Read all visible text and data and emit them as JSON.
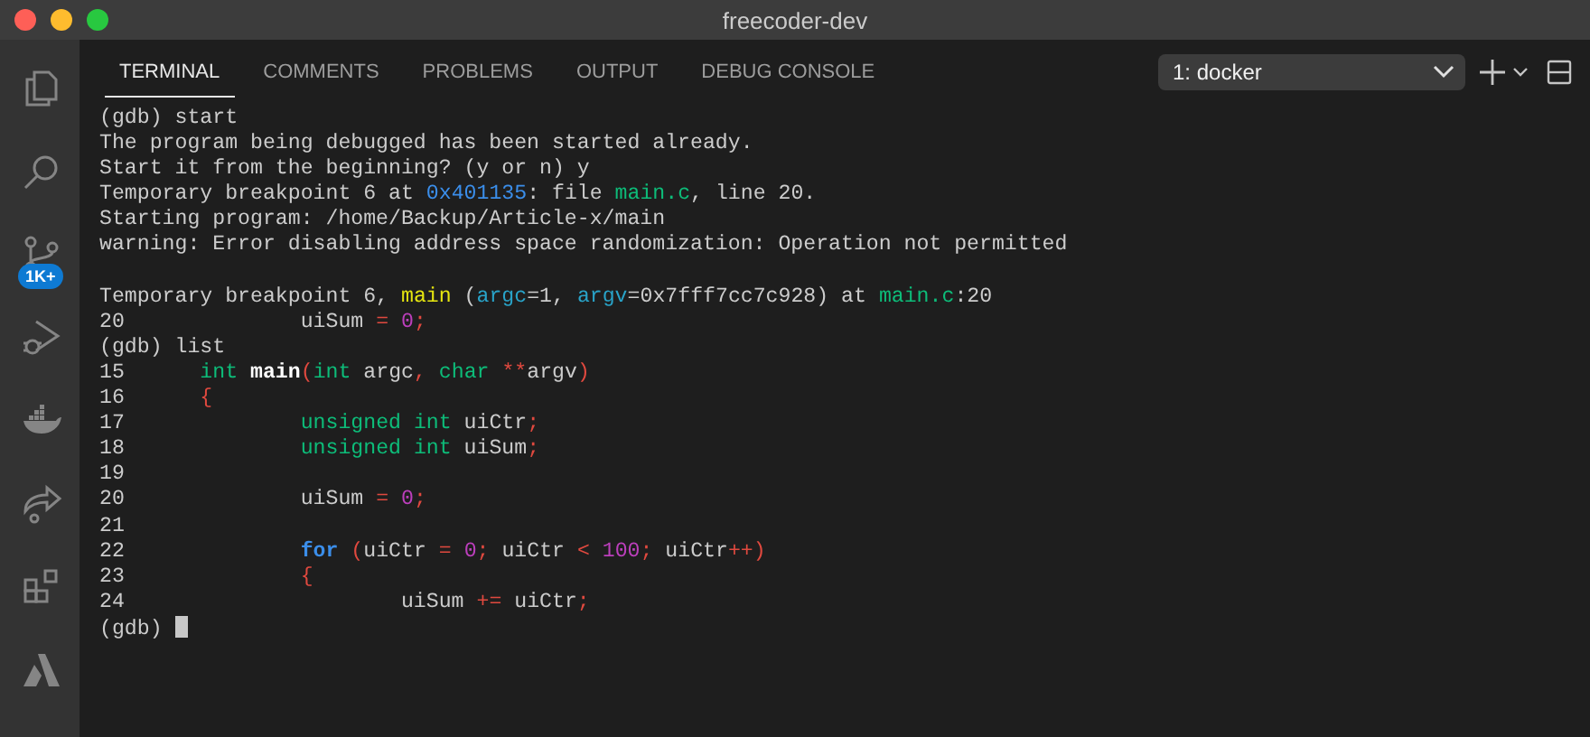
{
  "window": {
    "title": "freecoder-dev"
  },
  "activity_bar": {
    "items": [
      {
        "kind": "files",
        "selected": false
      },
      {
        "kind": "search",
        "selected": false
      },
      {
        "kind": "source-control",
        "selected": false,
        "badge": "1K+"
      },
      {
        "kind": "run-debug",
        "selected": false
      },
      {
        "kind": "docker",
        "selected": false
      },
      {
        "kind": "live-share",
        "selected": false
      },
      {
        "kind": "extensions",
        "selected": false
      },
      {
        "kind": "azure",
        "selected": false
      }
    ]
  },
  "panel_tabs": [
    {
      "label": "TERMINAL",
      "selected": true
    },
    {
      "label": "COMMENTS",
      "selected": false
    },
    {
      "label": "PROBLEMS",
      "selected": false
    },
    {
      "label": "OUTPUT",
      "selected": false
    },
    {
      "label": "DEBUG CONSOLE",
      "selected": false
    }
  ],
  "terminal_select": {
    "value": "1: docker"
  },
  "terminal": {
    "cursor": true,
    "lines": [
      {
        "kind": "text",
        "segments": [
          {
            "kind": "plain",
            "text": "(gdb) start"
          }
        ]
      },
      {
        "kind": "text",
        "segments": [
          {
            "kind": "plain",
            "text": "The program being debugged has been started already."
          }
        ]
      },
      {
        "kind": "text",
        "segments": [
          {
            "kind": "plain",
            "text": "Start it from the beginning? (y or n) y"
          }
        ]
      },
      {
        "kind": "text",
        "segments": [
          {
            "kind": "plain",
            "text": "Temporary breakpoint 6 at "
          },
          {
            "kind": "address",
            "text": "0x401135"
          },
          {
            "kind": "plain",
            "text": ": file "
          },
          {
            "kind": "file",
            "text": "main.c"
          },
          {
            "kind": "plain",
            "text": ", line 20."
          }
        ]
      },
      {
        "kind": "text",
        "segments": [
          {
            "kind": "plain",
            "text": "Starting program: /home/Backup/Article-x/main"
          }
        ]
      },
      {
        "kind": "text",
        "segments": [
          {
            "kind": "plain",
            "text": "warning: Error disabling address space randomization: Operation not permitted"
          }
        ]
      },
      {
        "kind": "blank"
      },
      {
        "kind": "text",
        "segments": [
          {
            "kind": "plain",
            "text": "Temporary breakpoint 6, "
          },
          {
            "kind": "function",
            "text": "main"
          },
          {
            "kind": "plain",
            "text": " ("
          },
          {
            "kind": "param",
            "text": "argc"
          },
          {
            "kind": "plain",
            "text": "=1, "
          },
          {
            "kind": "param",
            "text": "argv"
          },
          {
            "kind": "plain",
            "text": "=0x7fff7cc7c928) at "
          },
          {
            "kind": "file",
            "text": "main.c"
          },
          {
            "kind": "plain",
            "text": ":20"
          }
        ]
      },
      {
        "kind": "text",
        "segments": [
          {
            "kind": "plain",
            "text": "20              uiSum "
          },
          {
            "kind": "operator",
            "text": "= "
          },
          {
            "kind": "number",
            "text": "0"
          },
          {
            "kind": "operator",
            "text": ";"
          }
        ]
      },
      {
        "kind": "text",
        "segments": [
          {
            "kind": "plain",
            "text": "(gdb) list"
          }
        ]
      },
      {
        "kind": "text",
        "segments": [
          {
            "kind": "plain",
            "text": "15      "
          },
          {
            "kind": "type",
            "text": "int "
          },
          {
            "kind": "bold",
            "text": "main"
          },
          {
            "kind": "operator",
            "text": "("
          },
          {
            "kind": "type",
            "text": "int"
          },
          {
            "kind": "plain",
            "text": " argc"
          },
          {
            "kind": "operator",
            "text": ", "
          },
          {
            "kind": "type",
            "text": "char "
          },
          {
            "kind": "operator",
            "text": "**"
          },
          {
            "kind": "plain",
            "text": "argv"
          },
          {
            "kind": "operator",
            "text": ")"
          }
        ]
      },
      {
        "kind": "text",
        "segments": [
          {
            "kind": "plain",
            "text": "16      "
          },
          {
            "kind": "operator",
            "text": "{"
          }
        ]
      },
      {
        "kind": "text",
        "segments": [
          {
            "kind": "plain",
            "text": "17              "
          },
          {
            "kind": "type",
            "text": "unsigned int"
          },
          {
            "kind": "plain",
            "text": " uiCtr"
          },
          {
            "kind": "operator",
            "text": ";"
          }
        ]
      },
      {
        "kind": "text",
        "segments": [
          {
            "kind": "plain",
            "text": "18              "
          },
          {
            "kind": "type",
            "text": "unsigned int"
          },
          {
            "kind": "plain",
            "text": " uiSum"
          },
          {
            "kind": "operator",
            "text": ";"
          }
        ]
      },
      {
        "kind": "text",
        "segments": [
          {
            "kind": "plain",
            "text": "19"
          }
        ]
      },
      {
        "kind": "text",
        "segments": [
          {
            "kind": "plain",
            "text": "20              uiSum "
          },
          {
            "kind": "operator",
            "text": "= "
          },
          {
            "kind": "number",
            "text": "0"
          },
          {
            "kind": "operator",
            "text": ";"
          }
        ]
      },
      {
        "kind": "text",
        "segments": [
          {
            "kind": "plain",
            "text": "21"
          }
        ]
      },
      {
        "kind": "text",
        "segments": [
          {
            "kind": "plain",
            "text": "22              "
          },
          {
            "kind": "keyword",
            "text": "for "
          },
          {
            "kind": "operator",
            "text": "("
          },
          {
            "kind": "plain",
            "text": "uiCtr "
          },
          {
            "kind": "operator",
            "text": "= "
          },
          {
            "kind": "number",
            "text": "0"
          },
          {
            "kind": "operator",
            "text": ";"
          },
          {
            "kind": "plain",
            "text": " uiCtr "
          },
          {
            "kind": "operator",
            "text": "< "
          },
          {
            "kind": "number",
            "text": "100"
          },
          {
            "kind": "operator",
            "text": ";"
          },
          {
            "kind": "plain",
            "text": " uiCtr"
          },
          {
            "kind": "operator",
            "text": "++)"
          }
        ]
      },
      {
        "kind": "text",
        "segments": [
          {
            "kind": "plain",
            "text": "23              "
          },
          {
            "kind": "operator",
            "text": "{"
          }
        ]
      },
      {
        "kind": "text",
        "segments": [
          {
            "kind": "plain",
            "text": "24                      uiSum "
          },
          {
            "kind": "operator",
            "text": "+="
          },
          {
            "kind": "plain",
            "text": " uiCtr"
          },
          {
            "kind": "operator",
            "text": ";"
          }
        ]
      },
      {
        "kind": "text",
        "segments": [
          {
            "kind": "plain",
            "text": "(gdb) "
          }
        ]
      }
    ]
  }
}
